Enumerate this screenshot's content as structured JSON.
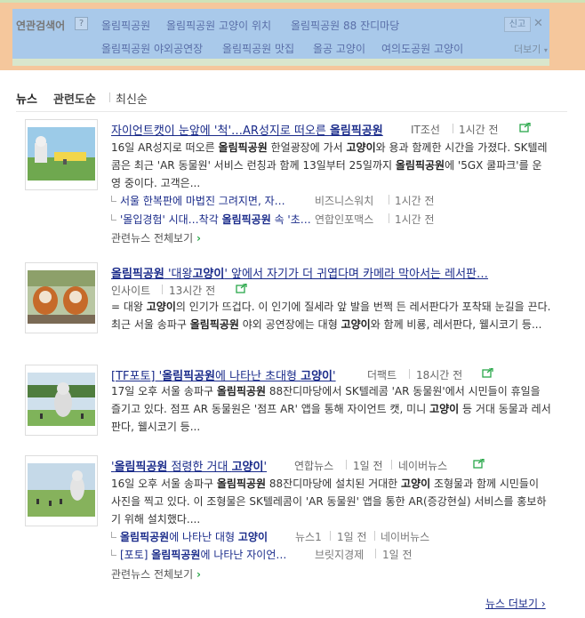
{
  "related": {
    "label": "연관검색어",
    "help": "?",
    "links": [
      "올림픽공원",
      "올림픽공원 고양이 위치",
      "올림픽공원 88 잔디마당",
      "올림픽공원 야외공연장",
      "올림픽공원 맛집",
      "올공 고양이",
      "여의도공원 고양이"
    ],
    "report": "신고",
    "close": "✕",
    "more": "더보기"
  },
  "tabs": [
    "뉴스",
    "관련도순",
    "최신순"
  ],
  "news": [
    {
      "title_pre": "자이언트캣이 눈앞에 '척'…AR성지로 떠오른 ",
      "title_bold": "올림픽공원",
      "title_post": "",
      "source": "IT조선",
      "time": "1시간 전",
      "desc_1": "16일 AR성지로 떠오른 ",
      "desc_b1": "올림픽공원",
      "desc_2": " 한얼광장에 가서 ",
      "desc_b2": "고양이",
      "desc_3": "와 용과 함께한 시간을 가졌다. SK텔레콤은 최근 'AR 동물원' 서비스 런칭과 함께 13일부터 25일까지 ",
      "desc_b3": "올림픽공원",
      "desc_4": "에 '5GX 쿨파크'를 운영 중이다. 고객은...",
      "subs": [
        {
          "text": "서울 한복판에 마법진 그려지면, 자…",
          "source": "비즈니스워치",
          "time": "1시간 전"
        },
        {
          "pre": "'몰입경험' 시대…착각 ",
          "bold": "올림픽공원",
          "post": " 속 '초…",
          "source": "연합인포맥스",
          "time": "1시간 전"
        }
      ],
      "all": "관련뉴스 전체보기"
    },
    {
      "title_pre": "",
      "title_bold": "올림픽공원",
      "title_mid": " '대왕",
      "title_bold2": "고양이",
      "title_post": "' 앞에서 자기가 더 귀엽다며 카메라 막아서는 레서판…",
      "source": "인사이트",
      "time": "13시간 전",
      "desc_1": "= 대왕 ",
      "desc_b1": "고양이",
      "desc_2": "의 인기가 뜨겁다. 이 인기에 질세라 앞 발을 번쩍 든 레서판다가 포착돼 눈길을 끈다.최근 서울 송파구 ",
      "desc_b2": "올림픽공원",
      "desc_3": " 야외 공연장에는 대형 ",
      "desc_b3": "고양이",
      "desc_4": "와 함께 비룡, 레서판다, 웰시코기 등..."
    },
    {
      "title_pre": "[TF포토] '",
      "title_bold": "올림픽공원",
      "title_mid": "에 나타난 초대형 ",
      "title_bold2": "고양이",
      "title_post": "'",
      "source": "더팩트",
      "time": "18시간 전",
      "desc_1": "17일 오후 서울 송파구 ",
      "desc_b1": "올림픽공원",
      "desc_2": " 88잔디마당에서 SK텔레콤 'AR 동물원'에서 시민들이 휴일을 즐기고 있다. 점프 AR 동물원은 '점프 AR' 앱을 통해 자이언트 캣, 미니 ",
      "desc_b2": "고양이",
      "desc_3": " 등 거대 동물과 레서판다, 웰시코기 등..."
    },
    {
      "title_pre": "'",
      "title_bold": "올림픽공원",
      "title_mid": " 점령한 거대 ",
      "title_bold2": "고양이",
      "title_post": "'",
      "source": "연합뉴스",
      "time": "1일 전",
      "extra_source": "네이버뉴스",
      "desc_1": "16일 오후 서울 송파구 ",
      "desc_b1": "올림픽공원",
      "desc_2": " 88잔디마당에 설치된 거대한 ",
      "desc_b2": "고양이",
      "desc_3": " 조형물과 함께 시민들이 사진을 찍고 있다. 이 조형물은 SK텔레콤이 'AR 동물원' 앱을 통한 AR(증강현실) 서비스를 홍보하기 위해 설치했다....",
      "subs": [
        {
          "pre": "",
          "bold": "올림픽공원",
          "post": "에 나타난 대형 ",
          "bold2": "고양이",
          "source": "뉴스1",
          "time": "1일 전",
          "extra": "네이버뉴스"
        },
        {
          "pre": "[포토] ",
          "bold": "올림픽공원",
          "post": "에 나타난 자이언…",
          "source": "브릿지경제",
          "time": "1일 전"
        }
      ],
      "all": "관련뉴스 전체보기"
    }
  ],
  "more_news": "뉴스 더보기",
  "colors": {
    "link": "#1a2b8a",
    "accent_green": "#2aa84a",
    "panel": "#a9c9ea",
    "outer": "#f5c79c"
  },
  "icons": {
    "external_link": "external-link-icon",
    "chevron": "chevron-right-icon"
  }
}
